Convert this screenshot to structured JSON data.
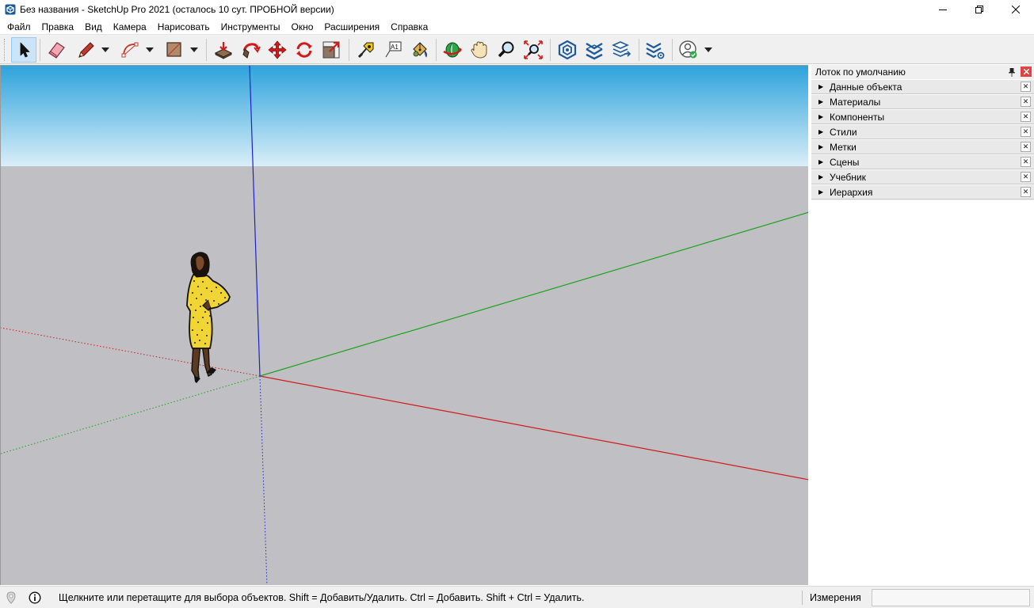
{
  "window": {
    "title": "Без названия - SketchUp Pro 2021 (осталось 10 сут. ПРОБНОЙ версии)",
    "app_icon": "sketchup-logo-icon",
    "controls": [
      "minimize-icon",
      "maximize-icon",
      "close-icon"
    ]
  },
  "menu": {
    "items": [
      "Файл",
      "Правка",
      "Вид",
      "Камера",
      "Нарисовать",
      "Инструменты",
      "Окно",
      "Расширения",
      "Справка"
    ]
  },
  "toolbar": {
    "tools": [
      {
        "icon": "select-arrow-icon",
        "active": true
      },
      {
        "icon": "eraser-icon"
      },
      {
        "icon": "pencil-line-icon",
        "dropdown": true
      },
      {
        "icon": "arc-icon",
        "dropdown": true
      },
      {
        "icon": "rectangle-icon",
        "dropdown": true
      },
      {
        "icon": "push-pull-icon"
      },
      {
        "icon": "follow-me-icon"
      },
      {
        "icon": "move-icon"
      },
      {
        "icon": "rotate-icon"
      },
      {
        "icon": "scale-icon"
      },
      {
        "icon": "tape-measure-icon"
      },
      {
        "icon": "text-icon"
      },
      {
        "icon": "paint-bucket-icon"
      },
      {
        "icon": "orbit-icon"
      },
      {
        "icon": "pan-hand-icon"
      },
      {
        "icon": "zoom-icon"
      },
      {
        "icon": "zoom-extents-icon"
      },
      {
        "icon": "3d-warehouse-icon"
      },
      {
        "icon": "extension-warehouse-icon"
      },
      {
        "icon": "layout-icon"
      },
      {
        "icon": "extension-manager-icon"
      },
      {
        "icon": "account-icon",
        "dropdown": true
      }
    ],
    "text_tool_label": "A1"
  },
  "viewport": {
    "colors": {
      "sky_top": "#2ea3dc",
      "sky_bottom": "#d9eef8",
      "ground": "#c0c0c4",
      "axis_red": "#d11b1b",
      "axis_green": "#19a319",
      "axis_blue": "#1f1fcc"
    },
    "scale_figure": "person-scale-figure"
  },
  "tray": {
    "title": "Лоток по умолчанию",
    "panels": [
      {
        "label": "Данные объекта"
      },
      {
        "label": "Материалы"
      },
      {
        "label": "Компоненты"
      },
      {
        "label": "Стили"
      },
      {
        "label": "Метки"
      },
      {
        "label": "Сцены"
      },
      {
        "label": "Учебник"
      },
      {
        "label": "Иерархия"
      }
    ]
  },
  "status": {
    "message": "Щелкните или перетащите для выбора объектов. Shift = Добавить/Удалить. Ctrl = Добавить. Shift + Ctrl = Удалить.",
    "measure_label": "Измерения",
    "measure_value": ""
  }
}
